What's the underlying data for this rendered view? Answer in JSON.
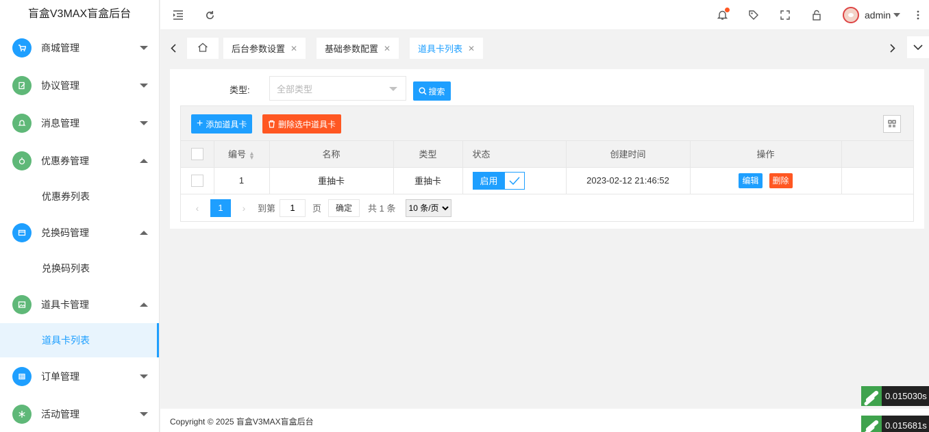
{
  "app": {
    "title": "盲盒V3MAX盲盒后台"
  },
  "sidebar": {
    "items": [
      {
        "label": "商城管理",
        "icon": "cart-icon",
        "color": "#1e9fff",
        "expanded": false
      },
      {
        "label": "协议管理",
        "icon": "document-edit-icon",
        "color": "#5fb878",
        "expanded": false
      },
      {
        "label": "消息管理",
        "icon": "bell-icon",
        "color": "#5fb878",
        "expanded": false
      },
      {
        "label": "优惠券管理",
        "icon": "coupon-icon",
        "color": "#5fb878",
        "expanded": true,
        "children": [
          "优惠券列表"
        ]
      },
      {
        "label": "兑换码管理",
        "icon": "card-icon",
        "color": "#1e9fff",
        "expanded": true,
        "children": [
          "兑换码列表"
        ]
      },
      {
        "label": "道具卡管理",
        "icon": "image-icon",
        "color": "#5fb878",
        "expanded": true,
        "children": [
          "道具卡列表"
        ],
        "active_child": "道具卡列表"
      },
      {
        "label": "订单管理",
        "icon": "table-icon",
        "color": "#1e9fff",
        "expanded": false
      },
      {
        "label": "活动管理",
        "icon": "snowflake-icon",
        "color": "#5fb878",
        "expanded": false
      }
    ]
  },
  "header": {
    "icons": [
      "menu-fold-icon",
      "refresh-icon",
      "bell-icon",
      "tag-icon",
      "fullscreen-icon",
      "lock-icon",
      "more-icon"
    ],
    "user_name": "admin"
  },
  "tabs": [
    {
      "label": "后台参数设置",
      "closable": true,
      "active": false
    },
    {
      "label": "基础参数配置",
      "closable": true,
      "active": false
    },
    {
      "label": "道具卡列表",
      "closable": true,
      "active": true
    }
  ],
  "filter": {
    "type_label": "类型:",
    "type_placeholder": "全部类型",
    "search_label": "搜索"
  },
  "toolbar": {
    "add_label": "添加道具卡",
    "delete_label": "删除选中道具卡"
  },
  "table": {
    "columns": [
      "编号",
      "名称",
      "类型",
      "状态",
      "创建时间",
      "操作"
    ],
    "rows": [
      {
        "id": "1",
        "name": "重抽卡",
        "type": "重抽卡",
        "status": "启用",
        "created": "2023-02-12 21:46:52",
        "edit": "编辑",
        "delete": "删除"
      }
    ]
  },
  "pager": {
    "current_page": "1",
    "goto_label": "到第",
    "goto_value": "1",
    "page_unit": "页",
    "confirm_label": "确定",
    "total_text": "共 1 条",
    "page_size": "10 条/页"
  },
  "footer": {
    "text": "Copyright © 2025 盲盒V3MAX盲盒后台"
  },
  "perf": [
    "0.015030s",
    "0.015681s"
  ],
  "colors": {
    "primary": "#1e9fff",
    "danger": "#ff5722",
    "green": "#5fb878"
  }
}
